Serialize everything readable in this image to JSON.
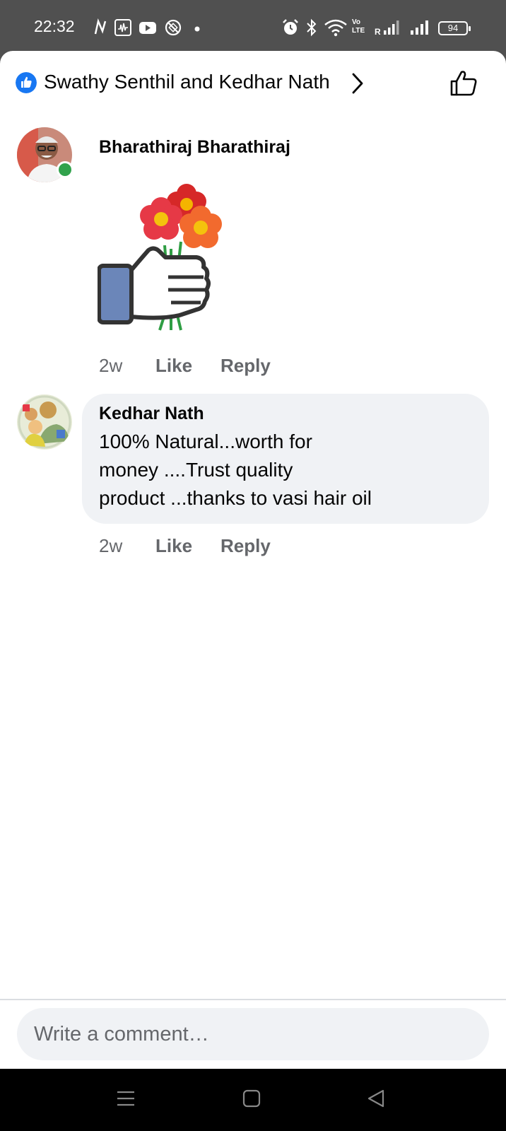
{
  "status_bar": {
    "time": "22:32",
    "battery": "94",
    "icons": [
      "n-icon",
      "activity-icon",
      "youtube-icon",
      "no-disturb-icon",
      "dot-icon",
      "alarm-icon",
      "bluetooth-icon",
      "wifi-icon",
      "volte-icon",
      "signal-icon",
      "signal-icon",
      "battery-icon"
    ],
    "volte_label_top": "Vo",
    "volte_label_bottom": "LTE",
    "roaming_label": "R"
  },
  "header": {
    "reaction_icon": "like-badge-icon",
    "title": "Swathy Senthil and Kedhar Nath",
    "accent_color": "#1877f2"
  },
  "comments": [
    {
      "author": "Bharathiraj Bharathiraj",
      "online": true,
      "content_type": "sticker",
      "sticker": "thumbs-up-flowers-sticker",
      "time": "2w",
      "like_label": "Like",
      "reply_label": "Reply"
    },
    {
      "author": "Kedhar Nath",
      "online": false,
      "content_type": "text",
      "text_lines": [
        "100% Natural...worth for",
        "money ....Trust quality",
        "product ...thanks to vasi hair oil"
      ],
      "time": "2w",
      "like_label": "Like",
      "reply_label": "Reply"
    }
  ],
  "composer": {
    "placeholder": "Write a comment…"
  },
  "nav_bar": {
    "buttons": [
      "menu-icon",
      "home-icon",
      "back-icon"
    ]
  }
}
